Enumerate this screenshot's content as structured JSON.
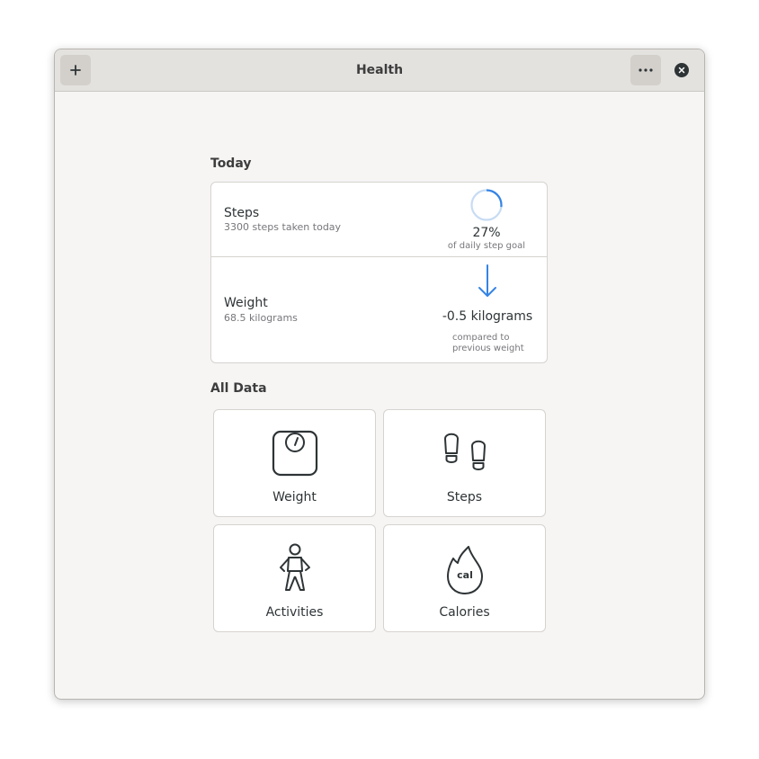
{
  "window": {
    "title": "Health"
  },
  "today": {
    "heading": "Today",
    "steps": {
      "title": "Steps",
      "subtitle": "3300 steps taken today",
      "percent": "27%",
      "percent_fraction": 0.27,
      "caption": "of daily step goal"
    },
    "weight": {
      "title": "Weight",
      "subtitle": "68.5 kilograms",
      "change": "-0.5 kilograms",
      "caption_line1": "compared to",
      "caption_line2": "previous weight"
    }
  },
  "all_data": {
    "heading": "All Data",
    "tiles": [
      {
        "label": "Weight",
        "icon": "scale-icon"
      },
      {
        "label": "Steps",
        "icon": "footprints-icon"
      },
      {
        "label": "Activities",
        "icon": "person-walking-icon"
      },
      {
        "label": "Calories",
        "icon": "flame-cal-icon",
        "icon_text": "cal"
      }
    ]
  },
  "colors": {
    "accent": "#3584e4",
    "ring_track": "#c7dcf3"
  }
}
